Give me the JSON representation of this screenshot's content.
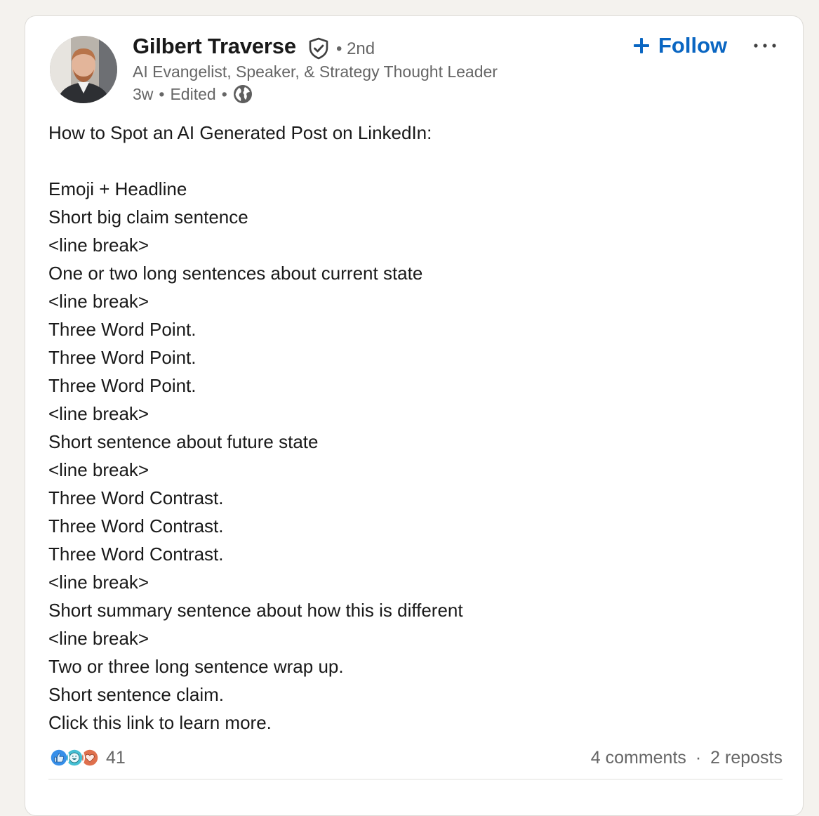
{
  "author": {
    "name": "Gilbert Traverse",
    "degree": "• 2nd",
    "headline": "AI Evangelist, Speaker, & Strategy Thought Leader",
    "time": "3w",
    "edited": "Edited",
    "separator": "•",
    "visibility_icon": "globe-icon",
    "verified_icon": "verified-shield-icon"
  },
  "actions": {
    "follow_label": "Follow",
    "follow_icon": "plus-icon",
    "more_icon": "ellipsis-icon"
  },
  "post": {
    "lines": [
      "How to Spot an AI Generated Post on LinkedIn:",
      "",
      "Emoji + Headline",
      "Short big claim sentence",
      "<line break>",
      "One or two long sentences about current state",
      "<line break>",
      "Three Word Point.",
      "Three Word Point.",
      "Three Word Point.",
      "<line break>",
      "Short sentence about future state",
      "<line break>",
      "Three Word Contrast.",
      "Three Word Contrast.",
      "Three Word Contrast.",
      "<line break>",
      "Short summary sentence about how this is different",
      "<line break>",
      "Two or three long sentence wrap up.",
      "Short sentence claim.",
      "Click this link to learn more."
    ]
  },
  "social": {
    "reaction_icons": [
      "like-icon",
      "funny-icon",
      "love-icon"
    ],
    "reaction_count": "41",
    "comments": "4 comments",
    "reposts": "2 reposts",
    "separator": "·"
  },
  "colors": {
    "accent": "#0a66c2",
    "text_primary": "#191919",
    "text_secondary": "#666666",
    "background": "#f4f2ee",
    "card": "#ffffff"
  }
}
